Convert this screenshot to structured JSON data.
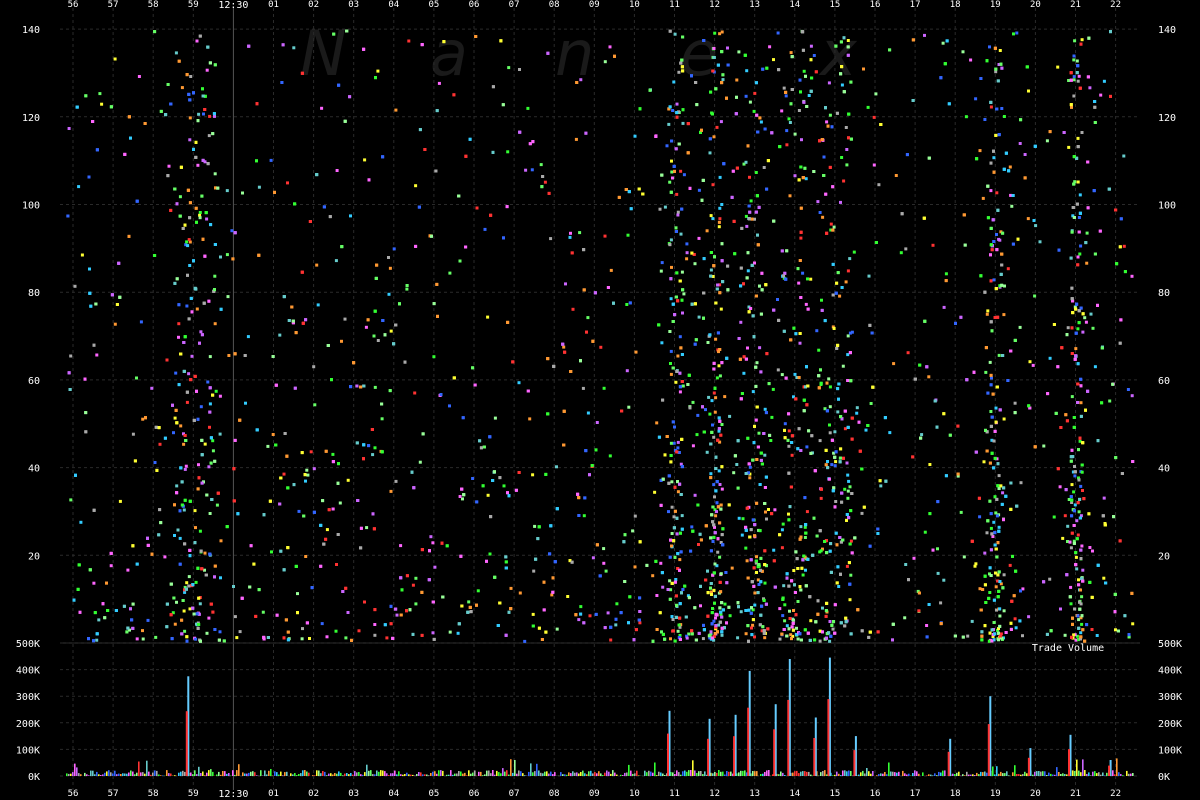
{
  "watermark": [
    "N",
    "a",
    "n",
    "e",
    "x"
  ],
  "chart_data": [
    {
      "type": "scatter",
      "panel": "price",
      "x_ticks": [
        "56",
        "57",
        "58",
        "59",
        "12:30",
        "01",
        "02",
        "03",
        "04",
        "05",
        "06",
        "07",
        "08",
        "09",
        "10",
        "11",
        "12",
        "13",
        "14",
        "15",
        "16",
        "17",
        "18",
        "19",
        "20",
        "21",
        "22"
      ],
      "y_ticks": [
        "20",
        "40",
        "60",
        "80",
        "100",
        "120",
        "140"
      ],
      "ylim": [
        0,
        142
      ],
      "grid": true,
      "activity_centers": [
        {
          "x": "59",
          "weight": 3.5
        },
        {
          "x": "11",
          "weight": 1.2
        },
        {
          "x": "12",
          "weight": 1.1
        },
        {
          "x": "13",
          "weight": 1.8
        },
        {
          "x": "14",
          "weight": 2.4
        },
        {
          "x": "15",
          "weight": 2.8
        },
        {
          "x": "19",
          "weight": 1.3
        },
        {
          "x": "21",
          "weight": 1.0
        }
      ],
      "marker_colors": [
        "#33ff33",
        "#66ff66",
        "#ff3333",
        "#3366ff",
        "#33ccff",
        "#ff66ff",
        "#cc66ff",
        "#66cccc",
        "#ffff33",
        "#99ff99",
        "#aaaaaa",
        "#ff9933"
      ]
    },
    {
      "type": "bar",
      "panel": "volume",
      "label": "Trade Volume",
      "y_ticks": [
        "0K",
        "100K",
        "200K",
        "300K",
        "400K",
        "500K"
      ],
      "ylim": [
        0,
        500000
      ],
      "spikes": [
        {
          "x": "59",
          "value": 375000
        },
        {
          "x": "11",
          "value": 245000
        },
        {
          "x": "12",
          "value": 215000
        },
        {
          "x": "12",
          "value": 230000
        },
        {
          "x": "13",
          "value": 395000
        },
        {
          "x": "13",
          "value": 270000
        },
        {
          "x": "14",
          "value": 440000
        },
        {
          "x": "14",
          "value": 220000
        },
        {
          "x": "15",
          "value": 445000
        },
        {
          "x": "15",
          "value": 150000
        },
        {
          "x": "18",
          "value": 140000
        },
        {
          "x": "19",
          "value": 300000
        },
        {
          "x": "20",
          "value": 105000
        },
        {
          "x": "21",
          "value": 155000
        },
        {
          "x": "22",
          "value": 60000
        }
      ]
    }
  ]
}
